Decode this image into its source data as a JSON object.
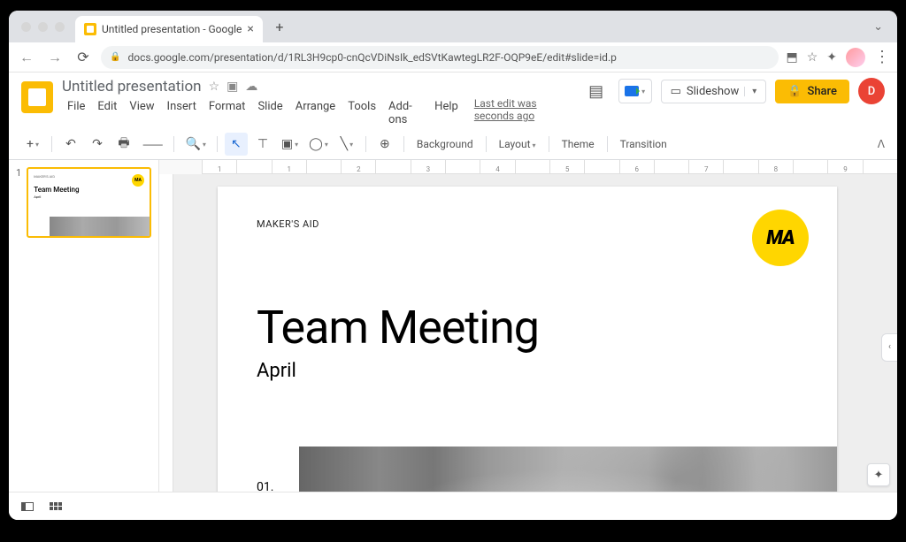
{
  "browser": {
    "tab_title": "Untitled presentation - Google",
    "url": "docs.google.com/presentation/d/1RL3H9cp0-cnQcVDiNsIk_edSVtKawtegLR2F-OQP9eE/edit#slide=id.p"
  },
  "header": {
    "doc_title": "Untitled presentation",
    "menus": [
      "File",
      "Edit",
      "View",
      "Insert",
      "Format",
      "Slide",
      "Arrange",
      "Tools",
      "Add-ons",
      "Help"
    ],
    "last_edit": "Last edit was seconds ago",
    "slideshow_label": "Slideshow",
    "share_label": "Share",
    "avatar_letter": "D"
  },
  "toolbar": {
    "background": "Background",
    "layout": "Layout",
    "theme": "Theme",
    "transition": "Transition"
  },
  "thumbnail": {
    "number": "1",
    "brand": "MAKER'S AID",
    "title": "Team Meeting",
    "subtitle": "April",
    "logo_text": "MA"
  },
  "slide": {
    "brand": "MAKER'S AID",
    "logo_text": "MA",
    "title": "Team Meeting",
    "subtitle": "April",
    "page_num": "01."
  },
  "ruler": [
    "1",
    "",
    "1",
    "",
    "2",
    "",
    "3",
    "",
    "4",
    "",
    "5",
    "",
    "6",
    "",
    "7",
    "",
    "8",
    "",
    "9",
    ""
  ]
}
